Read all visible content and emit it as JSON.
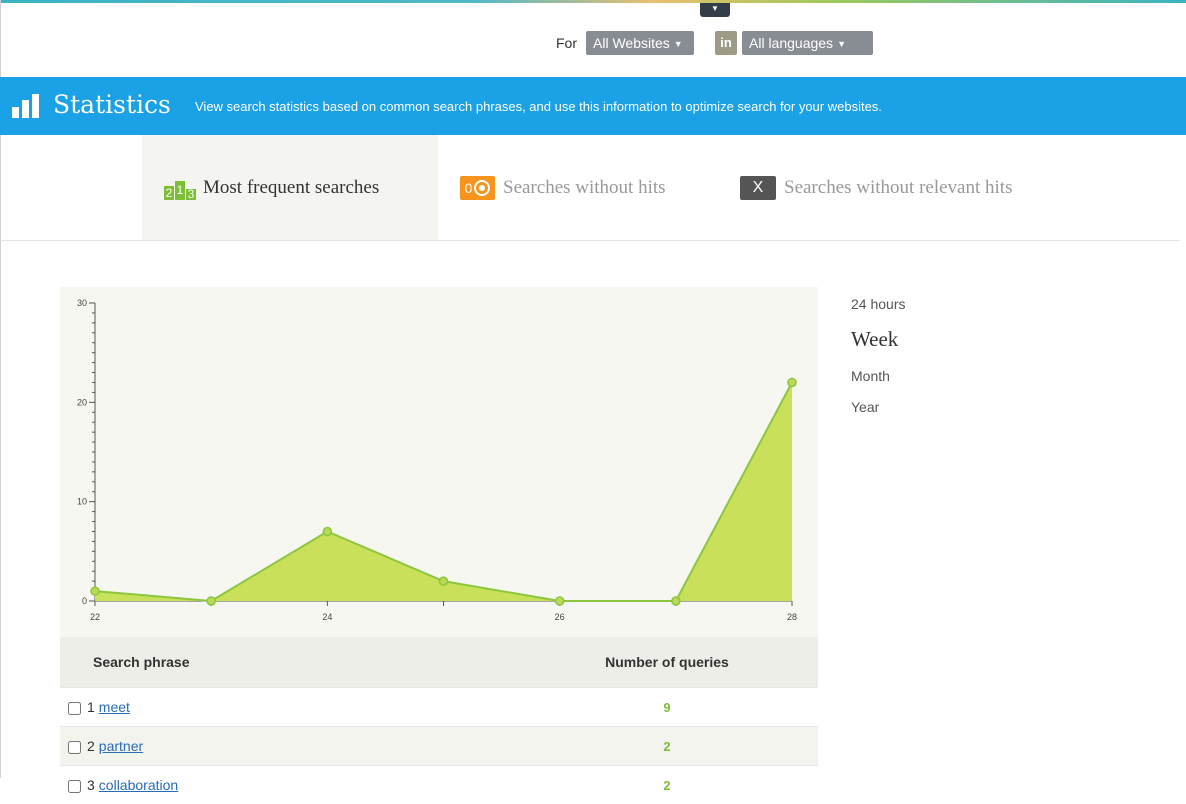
{
  "filters": {
    "for_label": "For",
    "website": "All Websites",
    "in_label": "in",
    "language": "All languages"
  },
  "banner": {
    "title": "Statistics",
    "description": "View search statistics based on common search phrases, and use this information to optimize search for your websites."
  },
  "tabs": [
    {
      "label": "Most frequent searches",
      "icon": "ranking-icon",
      "icon_text": [
        "2",
        "1",
        "3"
      ],
      "active": true
    },
    {
      "label": "Searches without hits",
      "icon": "zero-target-icon",
      "icon_text": "0",
      "active": false
    },
    {
      "label": "Searches without relevant hits",
      "icon": "x-icon",
      "icon_text": "X",
      "active": false
    }
  ],
  "periods": [
    "24 hours",
    "Week",
    "Month",
    "Year"
  ],
  "active_period": "Week",
  "chart_data": {
    "type": "area",
    "x": [
      22,
      23,
      24,
      25,
      26,
      27,
      28
    ],
    "series": [
      {
        "values": [
          1,
          0,
          7,
          2,
          0,
          0,
          22
        ]
      }
    ],
    "xticks": [
      22,
      24,
      26,
      28
    ],
    "yticks": [
      0,
      10,
      20,
      30
    ],
    "xlim": [
      22,
      28
    ],
    "ylim": [
      0,
      30
    ],
    "colors": {
      "fill": "#c8e05a",
      "line": "#8cc63f",
      "point": "#8cc63f"
    }
  },
  "table": {
    "headers": [
      "Search phrase",
      "Number of queries"
    ],
    "rows": [
      {
        "rank": "1",
        "phrase": "meet",
        "count": "9"
      },
      {
        "rank": "2",
        "phrase": "partner",
        "count": "2"
      },
      {
        "rank": "3",
        "phrase": "collaboration",
        "count": "2"
      }
    ]
  },
  "colors": {
    "accent": "#1ba1e6",
    "green": "#7cbf36",
    "orange": "#f7941d"
  }
}
